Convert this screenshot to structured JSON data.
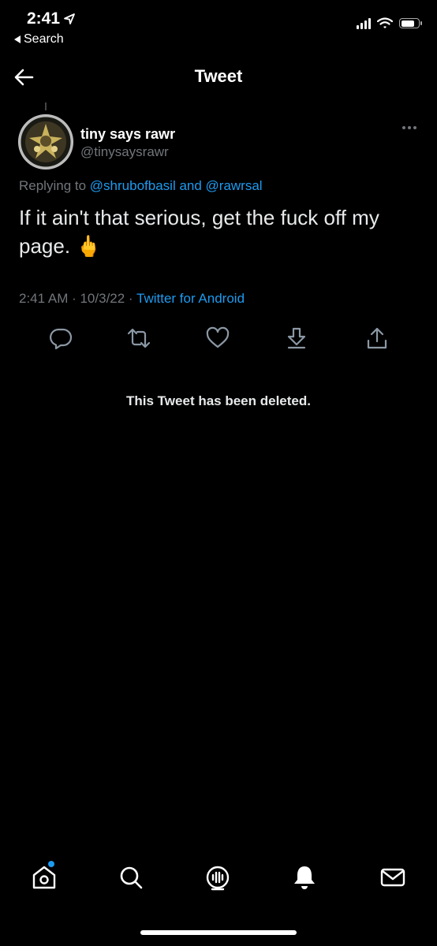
{
  "status_bar": {
    "time": "2:41",
    "back_label": "Search"
  },
  "header": {
    "title": "Tweet"
  },
  "tweet": {
    "display_name": "tiny says rawr",
    "username": "@tinysaysrawr",
    "replying_prefix": "Replying to",
    "replying_to": "@shrubofbasil and @rawrsal",
    "text": "If it ain't that serious, get the fuck off my page. 🖕",
    "timestamp": "2:41 AM · 10/3/22 ·",
    "source": "Twitter for Android"
  },
  "deleted_notice": "This Tweet has been deleted.",
  "colors": {
    "accent": "#1d9bf0",
    "background": "#000000",
    "secondary_text": "#71767b"
  },
  "actions": [
    "reply-icon",
    "retweet-icon",
    "like-icon",
    "bookmark-icon",
    "share-icon"
  ],
  "tabs": [
    "home-icon",
    "search-icon",
    "spaces-icon",
    "notifications-icon",
    "messages-icon"
  ]
}
